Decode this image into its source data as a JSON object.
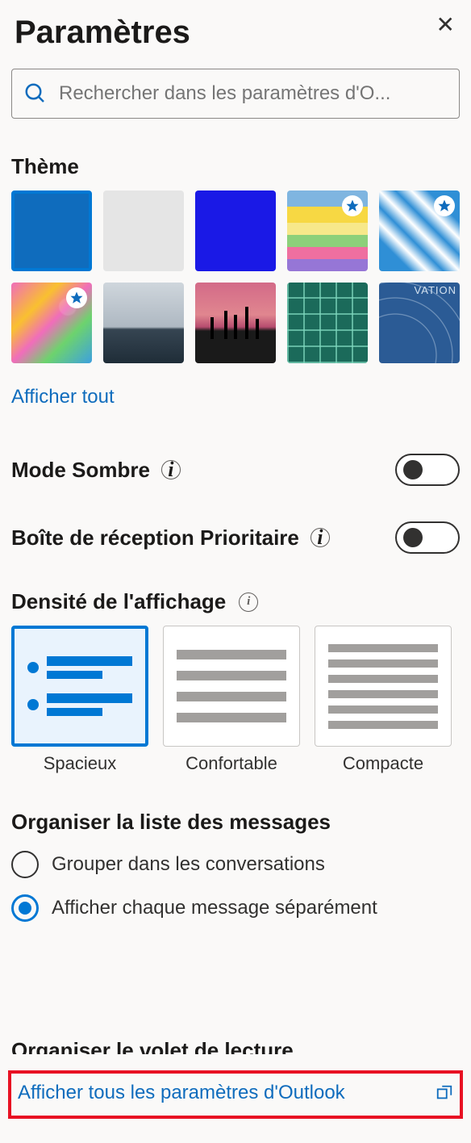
{
  "header": {
    "title": "Paramètres"
  },
  "search": {
    "placeholder": "Rechercher dans les paramètres d'O..."
  },
  "theme": {
    "title": "Thème",
    "show_all": "Afficher tout"
  },
  "dark_mode": {
    "label": "Mode Sombre",
    "enabled": false
  },
  "focused_inbox": {
    "label": "Boîte de réception Prioritaire",
    "enabled": false
  },
  "density": {
    "title": "Densité de l'affichage",
    "options": {
      "spacious": "Spacieux",
      "comfortable": "Confortable",
      "compact": "Compacte"
    },
    "selected": "spacious"
  },
  "organize_messages": {
    "title": "Organiser la liste des messages",
    "group_conversations": "Grouper dans les conversations",
    "show_separate": "Afficher chaque message séparément",
    "selected": "show_separate"
  },
  "reading_pane": {
    "title": "Organiser le volet de lecture"
  },
  "footer": {
    "all_settings": "Afficher tous les paramètres d'Outlook"
  }
}
